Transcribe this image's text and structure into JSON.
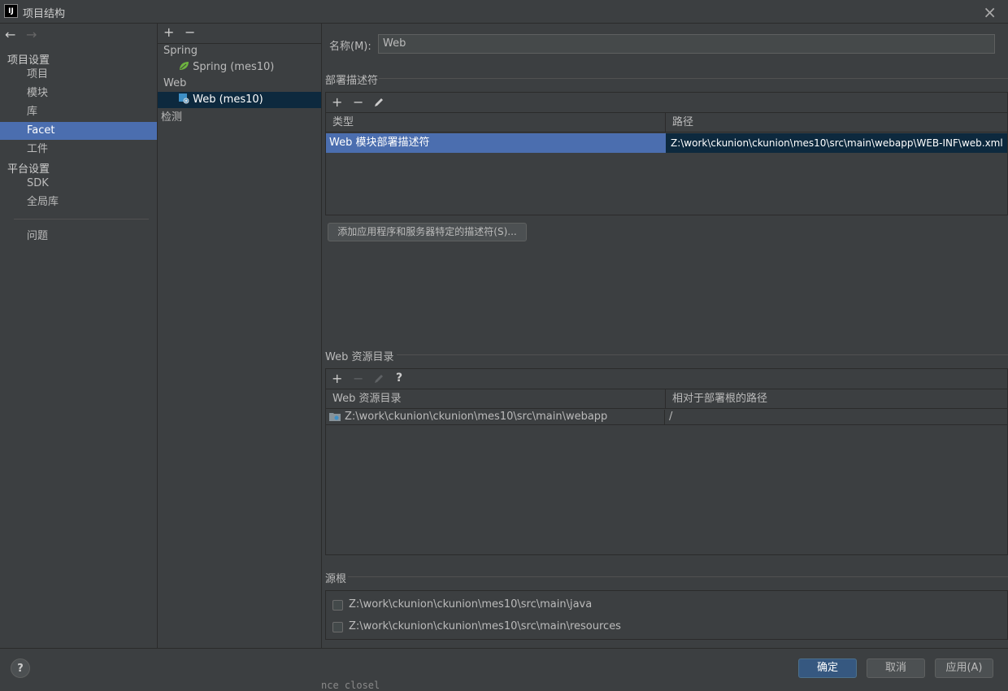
{
  "window": {
    "logo": "IJ",
    "title": "项目结构",
    "close_icon": "×"
  },
  "nav": {
    "back_icon": "←",
    "forward_icon": "→",
    "section_project": "项目设置",
    "items_project": [
      "项目",
      "模块",
      "库",
      "Facet",
      "工件"
    ],
    "section_platform": "平台设置",
    "items_platform": [
      "SDK",
      "全局库"
    ],
    "problems": "问题",
    "selected": "Facet"
  },
  "tree": {
    "add_icon": "+",
    "remove_icon": "−",
    "group_spring": "Spring",
    "item_spring": "Spring (mes10)",
    "group_web": "Web",
    "item_web": "Web (mes10)",
    "detection": "检测"
  },
  "name_field": {
    "label": "名称(M):",
    "value": "Web"
  },
  "deployment": {
    "title": "部署描述符",
    "col_type": "类型",
    "col_path": "路径",
    "rows": [
      {
        "type": "Web 模块部署描述符",
        "path": "Z:\\work\\ckunion\\ckunion\\mes10\\src\\main\\webapp\\WEB-INF\\web.xml"
      }
    ],
    "add_button": "添加应用程序和服务器特定的描述符(S)..."
  },
  "web_resources": {
    "title": "Web 资源目录",
    "col_dir": "Web 资源目录",
    "col_rel": "相对于部署根的路径",
    "help_icon": "?",
    "rows": [
      {
        "dir": "Z:\\work\\ckunion\\ckunion\\mes10\\src\\main\\webapp",
        "rel": "/"
      }
    ]
  },
  "source_roots": {
    "title": "源根",
    "items": [
      "Z:\\work\\ckunion\\ckunion\\mes10\\src\\main\\java",
      "Z:\\work\\ckunion\\ckunion\\mes10\\src\\main\\resources"
    ]
  },
  "footer": {
    "help": "?",
    "ok": "确定",
    "cancel": "取消",
    "apply": "应用(A)",
    "behind_text": "nce closel"
  },
  "colors": {
    "selection": "#4b6eaf",
    "primary_button": "#365880",
    "background": "#3c3f41"
  }
}
